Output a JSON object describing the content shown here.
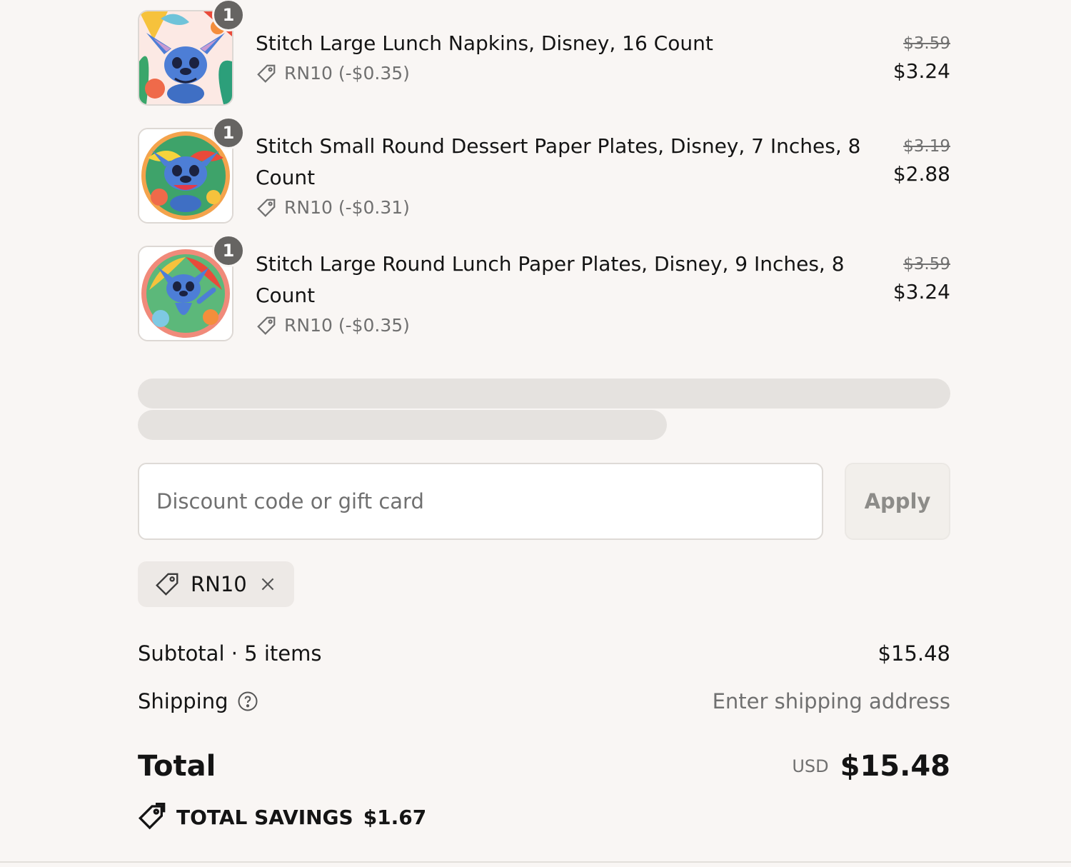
{
  "line_items": [
    {
      "quantity": "1",
      "title": "Stitch Large Lunch Napkins, Disney, 16 Count",
      "discount": "RN10 (-$0.35)",
      "original_price": "$3.59",
      "price": "$3.24",
      "image_icon": "stitch-napkin-icon"
    },
    {
      "quantity": "1",
      "title": "Stitch Small Round Dessert Paper Plates, Disney, 7 Inches, 8 Count",
      "discount": "RN10 (-$0.31)",
      "original_price": "$3.19",
      "price": "$2.88",
      "image_icon": "stitch-plate-icon"
    },
    {
      "quantity": "1",
      "title": "Stitch Large Round Lunch Paper Plates, Disney, 9 Inches, 8 Count",
      "discount": "RN10 (-$0.35)",
      "original_price": "$3.59",
      "price": "$3.24",
      "image_icon": "stitch-plate-icon"
    }
  ],
  "discount_form": {
    "placeholder": "Discount code or gift card",
    "value": "",
    "apply_label": "Apply"
  },
  "applied_code": {
    "code": "RN10"
  },
  "totals": {
    "subtotal_label": "Subtotal · 5 items",
    "subtotal_value": "$15.48",
    "shipping_label": "Shipping",
    "shipping_value": "Enter shipping address",
    "total_label": "Total",
    "currency": "USD",
    "total_value": "$15.48",
    "savings_label": "TOTAL SAVINGS",
    "savings_value": "$1.67"
  },
  "colors": {
    "background": "#f9f6f4",
    "text": "#141414",
    "muted": "#707070",
    "badge": "#666462",
    "skeleton": "#e5e2df"
  }
}
